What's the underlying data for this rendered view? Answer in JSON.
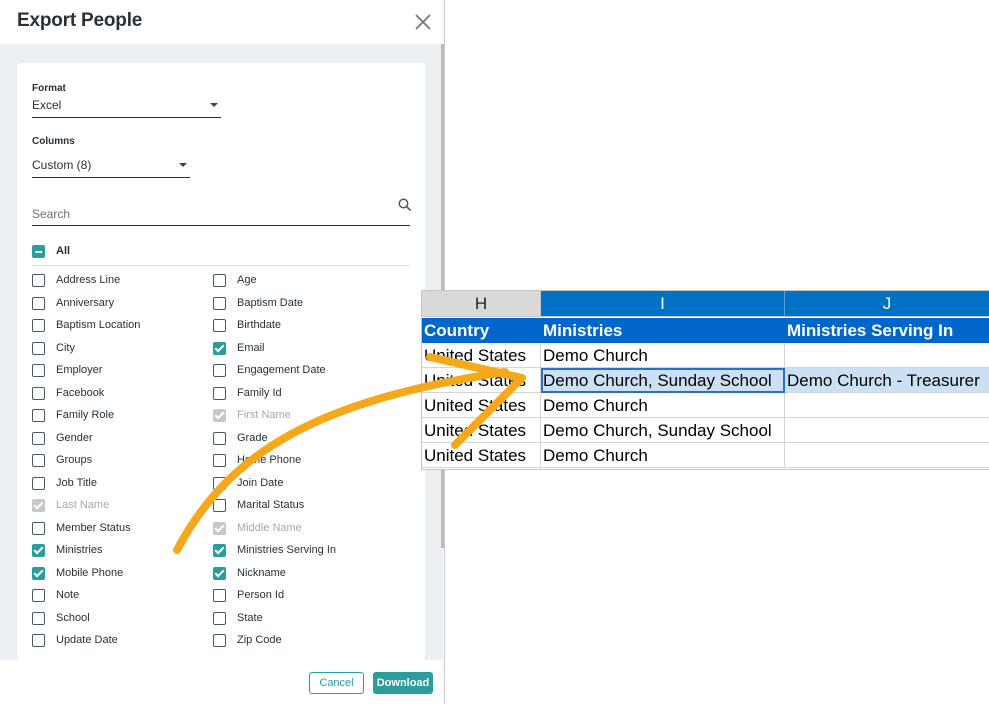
{
  "dialog": {
    "title": "Export People",
    "format": {
      "label": "Format",
      "value": "Excel"
    },
    "columns_select": {
      "label": "Columns",
      "value": "Custom (8)"
    },
    "search": {
      "placeholder": "Search"
    },
    "all_label": "All",
    "columns_left": [
      {
        "label": "Address Line",
        "state": "unchecked"
      },
      {
        "label": "Anniversary",
        "state": "unchecked"
      },
      {
        "label": "Baptism Location",
        "state": "unchecked"
      },
      {
        "label": "City",
        "state": "unchecked"
      },
      {
        "label": "Employer",
        "state": "unchecked"
      },
      {
        "label": "Facebook",
        "state": "unchecked"
      },
      {
        "label": "Family Role",
        "state": "unchecked"
      },
      {
        "label": "Gender",
        "state": "unchecked"
      },
      {
        "label": "Groups",
        "state": "unchecked"
      },
      {
        "label": "Job Title",
        "state": "unchecked"
      },
      {
        "label": "Last Name",
        "state": "disabled"
      },
      {
        "label": "Member Status",
        "state": "unchecked"
      },
      {
        "label": "Ministries",
        "state": "checked"
      },
      {
        "label": "Mobile Phone",
        "state": "checked"
      },
      {
        "label": "Note",
        "state": "unchecked"
      },
      {
        "label": "School",
        "state": "unchecked"
      },
      {
        "label": "Update Date",
        "state": "unchecked"
      }
    ],
    "columns_right": [
      {
        "label": "Age",
        "state": "unchecked"
      },
      {
        "label": "Baptism Date",
        "state": "unchecked"
      },
      {
        "label": "Birthdate",
        "state": "unchecked"
      },
      {
        "label": "Email",
        "state": "checked"
      },
      {
        "label": "Engagement Date",
        "state": "unchecked"
      },
      {
        "label": "Family Id",
        "state": "unchecked"
      },
      {
        "label": "First Name",
        "state": "disabled"
      },
      {
        "label": "Grade",
        "state": "unchecked"
      },
      {
        "label": "Home Phone",
        "state": "unchecked"
      },
      {
        "label": "Join Date",
        "state": "unchecked"
      },
      {
        "label": "Marital Status",
        "state": "unchecked"
      },
      {
        "label": "Middle Name",
        "state": "disabled"
      },
      {
        "label": "Ministries Serving In",
        "state": "checked"
      },
      {
        "label": "Nickname",
        "state": "checked"
      },
      {
        "label": "Person Id",
        "state": "unchecked"
      },
      {
        "label": "State",
        "state": "unchecked"
      },
      {
        "label": "Zip Code",
        "state": "unchecked"
      }
    ],
    "buttons": {
      "cancel": "Cancel",
      "download": "Download"
    }
  },
  "spreadsheet": {
    "column_letters": [
      "H",
      "I",
      "J"
    ],
    "headers": [
      "Country",
      "Ministries",
      "Ministries Serving In"
    ],
    "rows": [
      [
        "United States",
        "Demo Church",
        ""
      ],
      [
        "United States",
        "Demo Church, Sunday School",
        "Demo Church - Treasurer"
      ],
      [
        "United States",
        "Demo Church",
        ""
      ],
      [
        "United States",
        "Demo Church, Sunday School",
        ""
      ],
      [
        "United States",
        "Demo Church",
        ""
      ]
    ]
  },
  "colors": {
    "accent": "#2a9d9c",
    "excel_header": "#0066cc",
    "excel_selected_col": "#0072c6",
    "arrow": "#f5a91a"
  }
}
